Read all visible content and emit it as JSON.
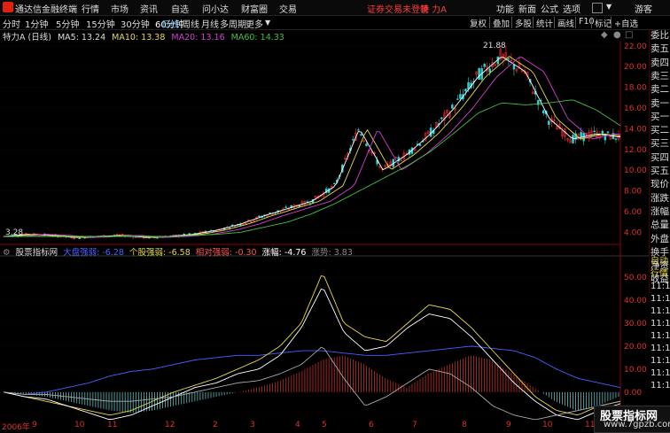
{
  "menubar": {
    "app_title": "通达信金融终端",
    "menus": [
      "行情",
      "市场",
      "资讯",
      "自选",
      "问小达",
      "财富圈",
      "交易"
    ],
    "warning": "证券交易未登录",
    "stock_name": "特 力A",
    "right_menus": [
      "功能",
      "新面",
      "公式",
      "选项"
    ],
    "user": "游客"
  },
  "toolbar": {
    "periods": [
      "分时",
      "1分钟",
      "5分钟",
      "15分钟",
      "30分钟",
      "60分钟",
      "日线",
      "周线",
      "月线",
      "多周期",
      "更多"
    ],
    "active_period": "日线",
    "right_buttons": [
      "复权",
      "叠加",
      "多股",
      "统计",
      "画线",
      "F10",
      "标记",
      "+自选",
      "返回"
    ]
  },
  "ma_header": {
    "title": "特力A (日线)",
    "ma5": "MA5: 13.24",
    "ma10": "MA10: 13.38",
    "ma20": "MA20: 13.16",
    "ma60": "MA60: 14.33",
    "colors": {
      "ma5": "#ffffff",
      "ma10": "#e8d84a",
      "ma20": "#d040d0",
      "ma60": "#40c040"
    }
  },
  "price_axis": [
    "22.00",
    "20.00",
    "18.00",
    "16.00",
    "14.00",
    "12.00",
    "10.00",
    "8.00",
    "6.00",
    "4.00"
  ],
  "annotations": {
    "high": "21.88",
    "low": "3.28"
  },
  "side_panel": [
    "委比",
    "卖五",
    "卖四",
    "卖三",
    "卖二",
    "卖一",
    "买一",
    "买二",
    "买三",
    "买四",
    "买五",
    "现价",
    "涨跌",
    "涨幅",
    "总量",
    "外盘",
    "换手",
    "净资",
    "收益"
  ],
  "indicator_header": {
    "title": "股票指标网",
    "s1": "大盘强弱: -6.28",
    "s2": "个股强弱: -6.58",
    "s3": "相对强弱: -0.30",
    "s4": "涨幅: -4.76",
    "s5": "涨势: 3.83",
    "colors": {
      "s1": "#4a60ff",
      "s2": "#e8d84a",
      "s3": "#ff5050",
      "s4": "#ffffff",
      "s5": "#888888"
    }
  },
  "indicator_axis": [
    "50.00",
    "40.00",
    "30.00",
    "20.00",
    "10.00",
    "0.00",
    "-10.00"
  ],
  "side_panel2": [
    "自动",
    "行情",
    "11:1",
    "11:1",
    "11:1",
    "11:1",
    "11:1",
    "11:1",
    "11:1",
    "11:1",
    "11:1"
  ],
  "x_axis": [
    "2006年",
    "9",
    "10",
    "11",
    "12",
    "2",
    "3",
    "4",
    "5",
    "6",
    "7",
    "8",
    "9",
    "10",
    "11"
  ],
  "watermark": {
    "title": "股票指标网",
    "url": "www.7gpzb.com"
  },
  "chart_data": {
    "type": "line",
    "series": [
      {
        "name": "MA5",
        "values": [
          3.6,
          3.8,
          3.7,
          3.5,
          3.6,
          3.7,
          3.5,
          3.6,
          3.8,
          4.2,
          4.8,
          5.6,
          6.3,
          7.0,
          8.5,
          14.0,
          10.0,
          11.5,
          13.5,
          16.0,
          19.0,
          21.0,
          19.5,
          15.0,
          13.0,
          13.5,
          13.2
        ]
      },
      {
        "name": "MA60",
        "values": [
          3.6,
          3.6,
          3.6,
          3.6,
          3.6,
          3.6,
          3.6,
          3.6,
          3.7,
          3.8,
          4.0,
          4.5,
          5.0,
          5.8,
          6.8,
          8.0,
          9.2,
          10.4,
          11.8,
          13.6,
          15.5,
          16.5,
          16.3,
          16.5,
          16.8,
          15.8,
          14.3
        ]
      }
    ],
    "ylim": [
      3,
      22.5
    ]
  }
}
